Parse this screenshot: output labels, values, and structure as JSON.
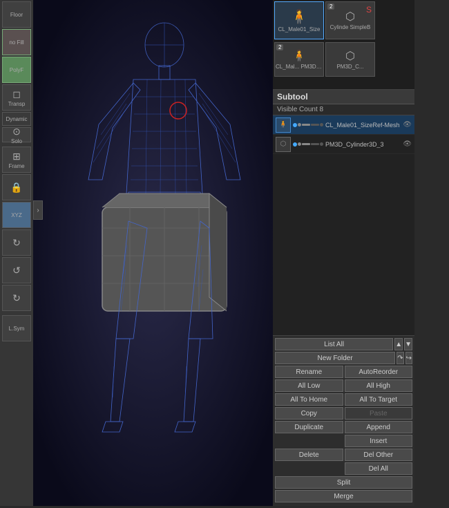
{
  "viewport": {
    "background": "#1a1a2e"
  },
  "toolbar_left": {
    "buttons": [
      {
        "id": "floor",
        "label": "Floor"
      },
      {
        "id": "nofill",
        "label": "no Fill",
        "active": true
      },
      {
        "id": "polyf",
        "label": "PolyF",
        "active": true
      },
      {
        "id": "transp",
        "label": "Transp"
      },
      {
        "id": "dynamic",
        "label": "Dynamic"
      },
      {
        "id": "solo",
        "label": "Solo"
      },
      {
        "id": "frame",
        "label": "Frame"
      },
      {
        "id": "lock",
        "label": "Lock"
      },
      {
        "id": "xyz",
        "label": "XYZ",
        "highlight": true
      },
      {
        "id": "rot1",
        "label": ""
      },
      {
        "id": "rot2",
        "label": ""
      },
      {
        "id": "rot3",
        "label": ""
      },
      {
        "id": "lsym",
        "label": "L.Sym"
      }
    ]
  },
  "top_thumbnails": {
    "rows": [
      {
        "items": [
          {
            "id": "cl_male_size",
            "label": "CL_Male01_Size",
            "badge": null,
            "icon": "👤"
          },
          {
            "id": "cylinder_simplebevel",
            "label": "Cylinde SimpleB...",
            "badge": "2",
            "icon": "⬡"
          },
          {
            "id": "sketch_icon",
            "label": "",
            "badge": null,
            "icon": "🔴"
          }
        ]
      },
      {
        "items": [
          {
            "id": "cl_mal_pm3d",
            "label": "CL_Mal... PM3D_...",
            "badge": "2",
            "icon": "👤"
          },
          {
            "id": "pm3d_c",
            "label": "PM3D_C...",
            "badge": null,
            "icon": "⬡"
          }
        ]
      }
    ]
  },
  "subtool": {
    "header": "Subtool",
    "visible_label": "Visible Count",
    "visible_count": "8",
    "items": [
      {
        "id": "cl_male01_sizeref",
        "name": "CL_Male01_SizeRef-Mesh",
        "selected": true,
        "controls": [
          "active",
          "inactive",
          "inactive",
          "inactive",
          "inactive"
        ],
        "eye_visible": true
      },
      {
        "id": "pm3d_cylinder3d",
        "name": "PM3D_Cylinder3D_3",
        "selected": false,
        "controls": [
          "active",
          "inactive",
          "inactive",
          "inactive",
          "inactive"
        ],
        "eye_visible": true
      }
    ]
  },
  "buttons": {
    "row1": [
      {
        "id": "list_all",
        "label": "List All"
      },
      {
        "id": "arrow_up",
        "label": "▲"
      },
      {
        "id": "arrow_down",
        "label": "▼"
      }
    ],
    "row2": [
      {
        "id": "new_folder",
        "label": "New Folder"
      },
      {
        "id": "arrow_right",
        "label": "↷"
      },
      {
        "id": "arrow_subdown",
        "label": "↪"
      }
    ],
    "row3": [
      {
        "id": "rename",
        "label": "Rename"
      },
      {
        "id": "auto_reorder",
        "label": "AutoReorder"
      }
    ],
    "row4": [
      {
        "id": "all_low",
        "label": "All Low"
      },
      {
        "id": "all_high",
        "label": "All High"
      }
    ],
    "row5": [
      {
        "id": "all_to_home",
        "label": "All To Home"
      },
      {
        "id": "all_to_target",
        "label": "All To Target"
      }
    ],
    "row6": [
      {
        "id": "copy",
        "label": "Copy"
      },
      {
        "id": "paste",
        "label": "Paste",
        "disabled": true
      }
    ],
    "row7": [
      {
        "id": "duplicate",
        "label": "Duplicate"
      },
      {
        "id": "append",
        "label": "Append"
      }
    ],
    "row8": [
      {
        "id": "duplicate_spacer",
        "label": ""
      },
      {
        "id": "insert",
        "label": "Insert"
      }
    ],
    "row9": [
      {
        "id": "delete",
        "label": "Delete"
      },
      {
        "id": "del_other",
        "label": "Del Other"
      }
    ],
    "row10": [
      {
        "id": "delete_spacer",
        "label": ""
      },
      {
        "id": "del_all",
        "label": "Del All"
      }
    ],
    "row11": [
      {
        "id": "split",
        "label": "Split"
      }
    ],
    "row12": [
      {
        "id": "merge",
        "label": "Merge"
      }
    ]
  }
}
